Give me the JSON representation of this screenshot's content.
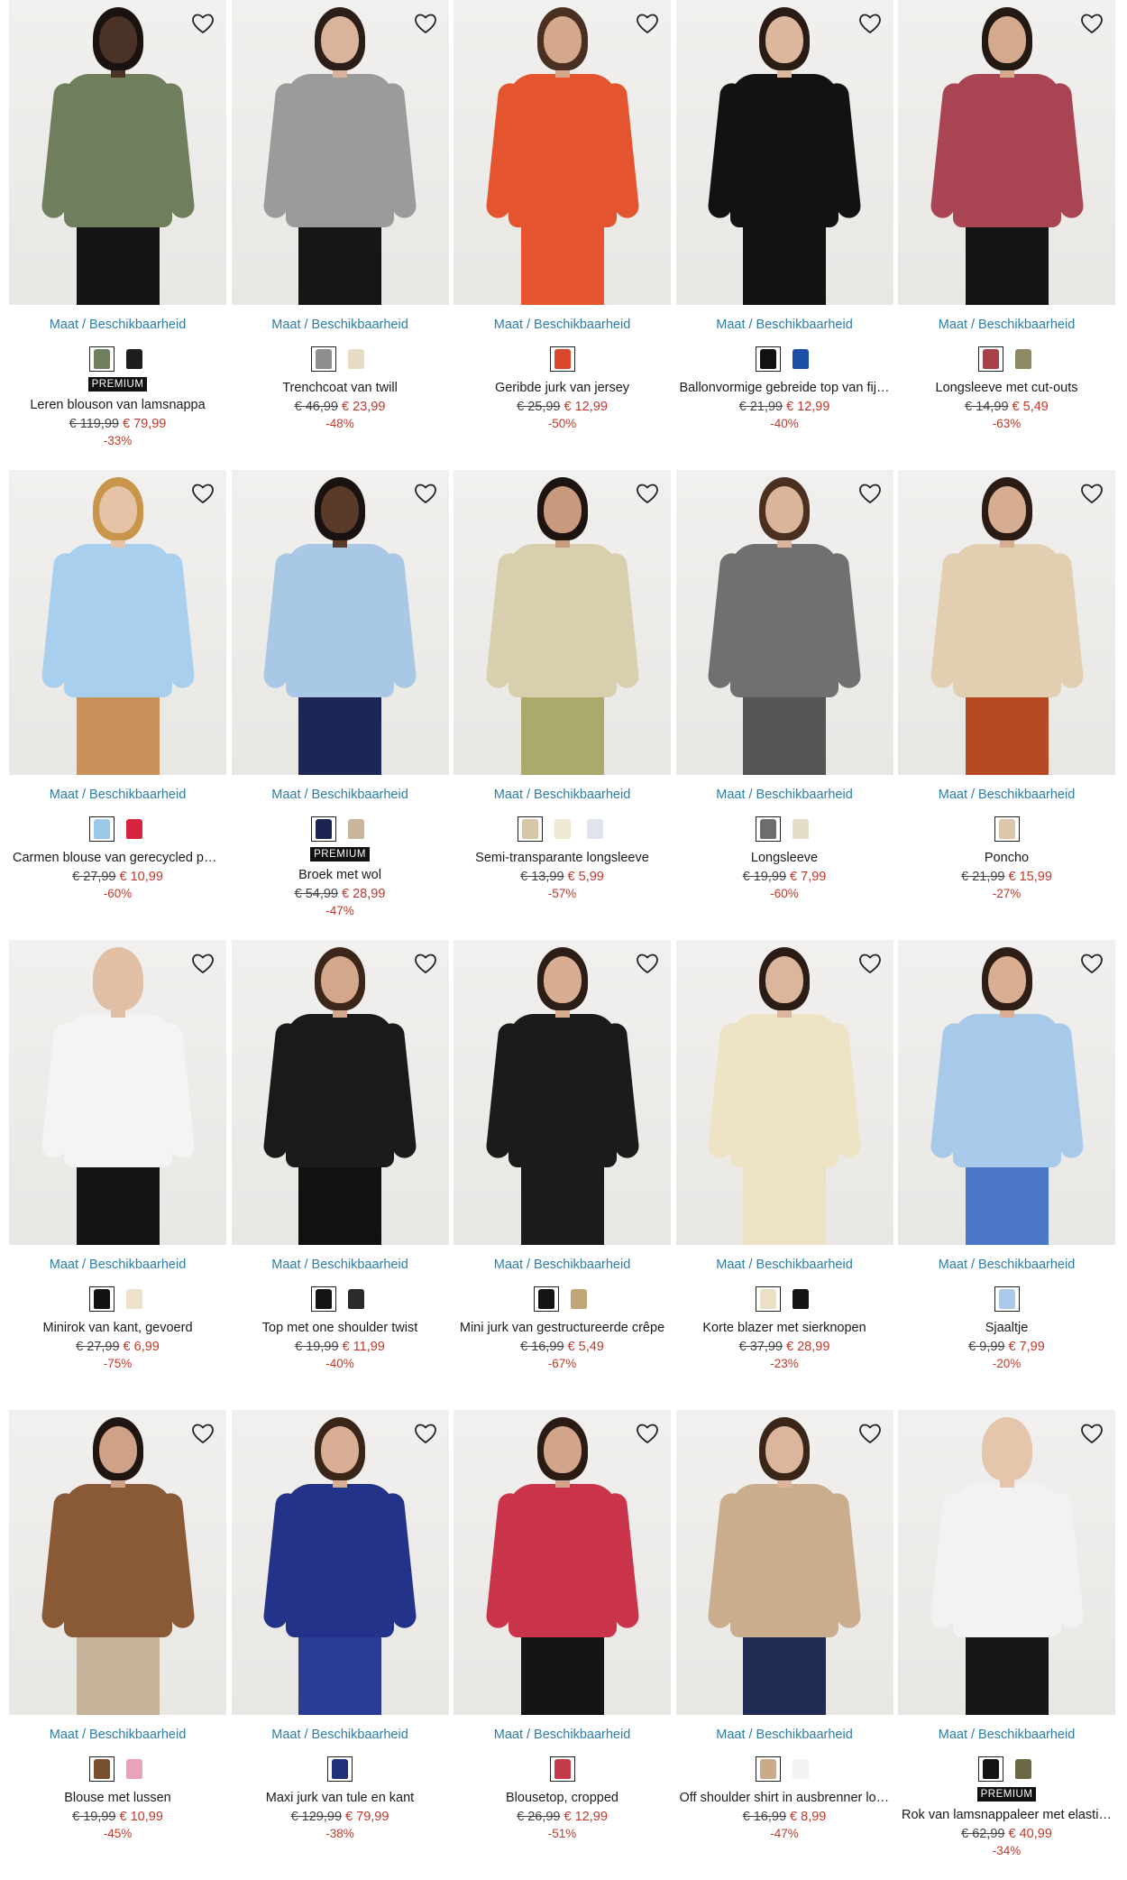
{
  "availability_label": "Maat / Beschikbaarheid",
  "currency": "€",
  "products": [
    {
      "name": "Leren blouson van lamsnappa",
      "old": "€ 119,99",
      "new": "€ 79,99",
      "discount": "-33%",
      "badge": "PREMIUM",
      "swatches": [
        {
          "color": "#6f7e5c",
          "selected": true
        },
        {
          "color": "#1e1e1e",
          "selected": false
        }
      ],
      "look": {
        "skin": "#4a3226",
        "hair": "#1a1210",
        "top": "#6f7e5c",
        "bottom": "#151515"
      }
    },
    {
      "name": "Trenchcoat van twill",
      "old": "€ 46,99",
      "new": "€ 23,99",
      "discount": "-48%",
      "badge": "",
      "swatches": [
        {
          "color": "#8e8e8e",
          "selected": true
        },
        {
          "color": "#e6dcc6",
          "selected": false
        }
      ],
      "look": {
        "skin": "#d9b49a",
        "hair": "#2b1d17",
        "top": "#9a9b9b",
        "bottom": "#161616"
      }
    },
    {
      "name": "Geribde jurk van jersey",
      "old": "€ 25,99",
      "new": "€ 12,99",
      "discount": "-50%",
      "badge": "",
      "swatches": [
        {
          "color": "#d9482b",
          "selected": true
        }
      ],
      "look": {
        "skin": "#d6a88b",
        "hair": "#4a3022",
        "top": "#e4552f",
        "bottom": "#e4552f"
      }
    },
    {
      "name": "Ballonvormige gebreide top van fijn gebreid",
      "old": "€ 21,99",
      "new": "€ 12,99",
      "discount": "-40%",
      "badge": "",
      "swatches": [
        {
          "color": "#111111",
          "selected": true
        },
        {
          "color": "#1d4fa8",
          "selected": false
        }
      ],
      "look": {
        "skin": "#dcb79c",
        "hair": "#2a1c15",
        "top": "#121212",
        "bottom": "#121212"
      }
    },
    {
      "name": "Longsleeve met cut-outs",
      "old": "€ 14,99",
      "new": "€ 5,49",
      "discount": "-63%",
      "badge": "",
      "swatches": [
        {
          "color": "#a8404a",
          "selected": true
        },
        {
          "color": "#8d8a63",
          "selected": false
        }
      ],
      "look": {
        "skin": "#d5a98e",
        "hair": "#241812",
        "top": "#a94552",
        "bottom": "#141414"
      }
    },
    {
      "name": "Carmen blouse van gerecycled polyester",
      "old": "€ 27,99",
      "new": "€ 10,99",
      "discount": "-60%",
      "badge": "",
      "swatches": [
        {
          "color": "#9cc8e8",
          "selected": true
        },
        {
          "color": "#d8253f",
          "selected": false
        }
      ],
      "look": {
        "skin": "#e6c3a7",
        "hair": "#c8954a",
        "top": "#a8d0ee",
        "bottom": "#c9915c"
      }
    },
    {
      "name": "Broek met wol",
      "old": "€ 54,99",
      "new": "€ 28,99",
      "discount": "-47%",
      "badge": "PREMIUM",
      "swatches": [
        {
          "color": "#1b2550",
          "selected": true
        },
        {
          "color": "#c9b49c",
          "selected": false
        }
      ],
      "look": {
        "skin": "#5a3b2a",
        "hair": "#1a1210",
        "top": "#a9c8e6",
        "bottom": "#1c2757"
      }
    },
    {
      "name": "Semi-transparante longsleeve",
      "old": "€ 13,99",
      "new": "€ 5,99",
      "discount": "-57%",
      "badge": "",
      "swatches": [
        {
          "color": "#d6c7a6",
          "selected": true
        },
        {
          "color": "#efe9d4",
          "selected": false
        },
        {
          "color": "#dfe4ee",
          "selected": false
        }
      ],
      "look": {
        "skin": "#c99a7e",
        "hair": "#1d1411",
        "top": "#d8cfae",
        "bottom": "#a9aa6c"
      }
    },
    {
      "name": "Longsleeve",
      "old": "€ 19,99",
      "new": "€ 7,99",
      "discount": "-60%",
      "badge": "",
      "swatches": [
        {
          "color": "#6d6d6b",
          "selected": true
        },
        {
          "color": "#e3dcc8",
          "selected": false
        }
      ],
      "look": {
        "skin": "#dbb59a",
        "hair": "#4b3022",
        "top": "#707070",
        "bottom": "#555555"
      }
    },
    {
      "name": "Poncho",
      "old": "€ 21,99",
      "new": "€ 15,99",
      "discount": "-27%",
      "badge": "",
      "swatches": [
        {
          "color": "#dcc5a8",
          "selected": true
        }
      ],
      "look": {
        "skin": "#d7ad92",
        "hair": "#2a1b15",
        "top": "#e2cfb2",
        "bottom": "#b54a25"
      }
    },
    {
      "name": "Minirok van kant, gevoerd",
      "old": "€ 27,99",
      "new": "€ 6,99",
      "discount": "-75%",
      "badge": "",
      "swatches": [
        {
          "color": "#121212",
          "selected": true
        },
        {
          "color": "#efe2cc",
          "selected": false
        }
      ],
      "look": {
        "skin": "#e0bfa4",
        "hair": "#e0bfa4",
        "top": "#f4f4f4",
        "bottom": "#151515"
      }
    },
    {
      "name": "Top met one shoulder twist",
      "old": "€ 19,99",
      "new": "€ 11,99",
      "discount": "-40%",
      "badge": "",
      "swatches": [
        {
          "color": "#141414",
          "selected": true
        },
        {
          "color": "#2b2b2b",
          "selected": false
        }
      ],
      "look": {
        "skin": "#d2a78c",
        "hair": "#3c2619",
        "top": "#1a1a1a",
        "bottom": "#111111"
      }
    },
    {
      "name": "Mini jurk van gestructureerde crêpe",
      "old": "€ 16,99",
      "new": "€ 5,49",
      "discount": "-67%",
      "badge": "",
      "swatches": [
        {
          "color": "#141414",
          "selected": true
        },
        {
          "color": "#c0a578",
          "selected": false
        }
      ],
      "look": {
        "skin": "#d8ad92",
        "hair": "#2c1d16",
        "top": "#1b1b1b",
        "bottom": "#1b1b1b"
      }
    },
    {
      "name": "Korte blazer met sierknopen",
      "old": "€ 37,99",
      "new": "€ 28,99",
      "discount": "-23%",
      "badge": "",
      "swatches": [
        {
          "color": "#ecdfc4",
          "selected": true
        },
        {
          "color": "#151515",
          "selected": false
        }
      ],
      "look": {
        "skin": "#dcb69c",
        "hair": "#2b1c15",
        "top": "#efe3c6",
        "bottom": "#eee2c6"
      }
    },
    {
      "name": "Sjaaltje",
      "old": "€ 9,99",
      "new": "€ 7,99",
      "discount": "-20%",
      "badge": "",
      "swatches": [
        {
          "color": "#a9cae8",
          "selected": true
        }
      ],
      "look": {
        "skin": "#d9ae93",
        "hair": "#2e1e16",
        "top": "#a7c9ea",
        "bottom": "#4a78c6"
      }
    },
    {
      "name": "Blouse met lussen",
      "old": "€ 19,99",
      "new": "€ 10,99",
      "discount": "-45%",
      "badge": "",
      "swatches": [
        {
          "color": "#7a4f30",
          "selected": true
        },
        {
          "color": "#e9a2bc",
          "selected": false
        }
      ],
      "look": {
        "skin": "#cfa186",
        "hair": "#1f1511",
        "top": "#8a5a36",
        "bottom": "#c7b39a"
      }
    },
    {
      "name": "Maxi jurk van tule en kant",
      "old": "€ 129,99",
      "new": "€ 79,99",
      "discount": "-38%",
      "badge": "",
      "swatches": [
        {
          "color": "#1f2f7a",
          "selected": true
        }
      ],
      "look": {
        "skin": "#d8ae94",
        "hair": "#3a2618",
        "top": "#23338a",
        "bottom": "#2a3c95"
      }
    },
    {
      "name": "Blousetop, cropped",
      "old": "€ 26,99",
      "new": "€ 12,99",
      "discount": "-51%",
      "badge": "",
      "swatches": [
        {
          "color": "#c43a4a",
          "selected": true
        }
      ],
      "look": {
        "skin": "#d2a58a",
        "hair": "#2a1b14",
        "top": "#c9344a",
        "bottom": "#151515"
      }
    },
    {
      "name": "Off shoulder shirt in ausbrenner look",
      "old": "€ 16,99",
      "new": "€ 8,99",
      "discount": "-47%",
      "badge": "",
      "swatches": [
        {
          "color": "#c9ab8a",
          "selected": true
        },
        {
          "color": "#f2f2f2",
          "selected": false
        }
      ],
      "look": {
        "skin": "#dcb69c",
        "hair": "#3a2619",
        "top": "#c9ad8d",
        "bottom": "#1f2b52"
      }
    },
    {
      "name": "Rok van lamsnappaleer met elastische band",
      "old": "€ 62,99",
      "new": "€ 40,99",
      "discount": "-34%",
      "badge": "PREMIUM",
      "swatches": [
        {
          "color": "#141414",
          "selected": true
        },
        {
          "color": "#6b6843",
          "selected": false
        }
      ],
      "look": {
        "skin": "#e4c6ad",
        "hair": "#e4c6ad",
        "top": "#f2f2f2",
        "bottom": "#161616"
      }
    }
  ]
}
